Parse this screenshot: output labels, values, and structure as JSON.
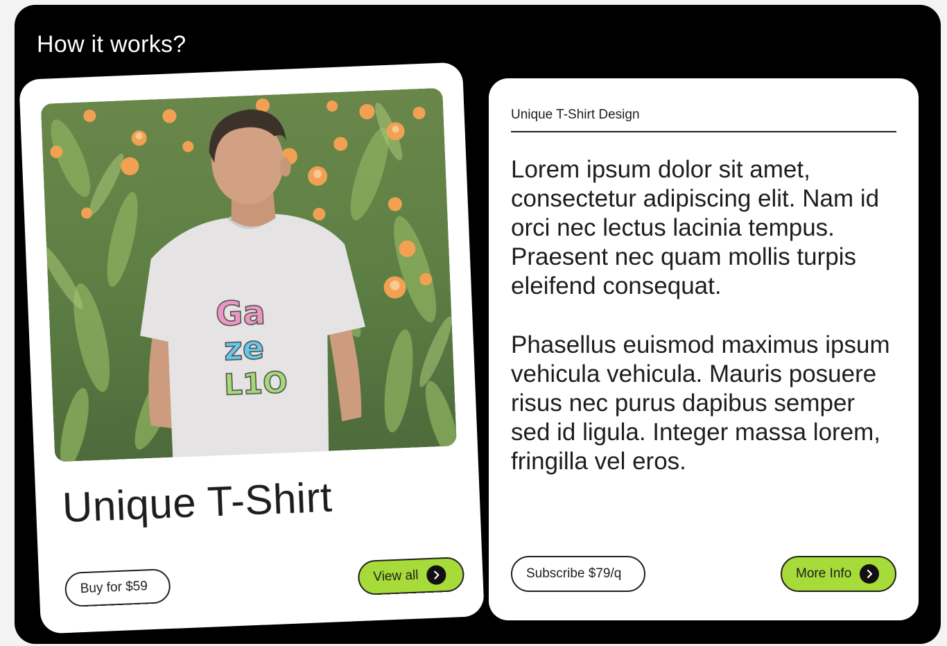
{
  "section": {
    "heading": "How it works?"
  },
  "product_card": {
    "title": "Unique T-Shirt",
    "shirt_print": [
      "Ga",
      "ze",
      "L1O"
    ],
    "buy_label": "Buy for $59",
    "view_all_label": "View all",
    "accent_color": "#a6db3a"
  },
  "info_card": {
    "kicker": "Unique T-Shirt Design",
    "paragraphs": [
      "Lorem ipsum dolor sit amet, consectetur adipiscing elit. Nam id orci nec lectus lacinia tempus. Praesent nec quam mollis turpis eleifend consequat.",
      "Phasellus euismod maximus ipsum vehicula vehicula. Mauris posuere risus nec purus dapibus semper sed id ligula. Integer massa lorem, fringilla vel eros."
    ],
    "subscribe_label": "Subscribe $79/q",
    "more_info_label": "More Info",
    "accent_color": "#a6db3a"
  },
  "icons": {
    "button_arrow": "chevron-right-icon"
  }
}
